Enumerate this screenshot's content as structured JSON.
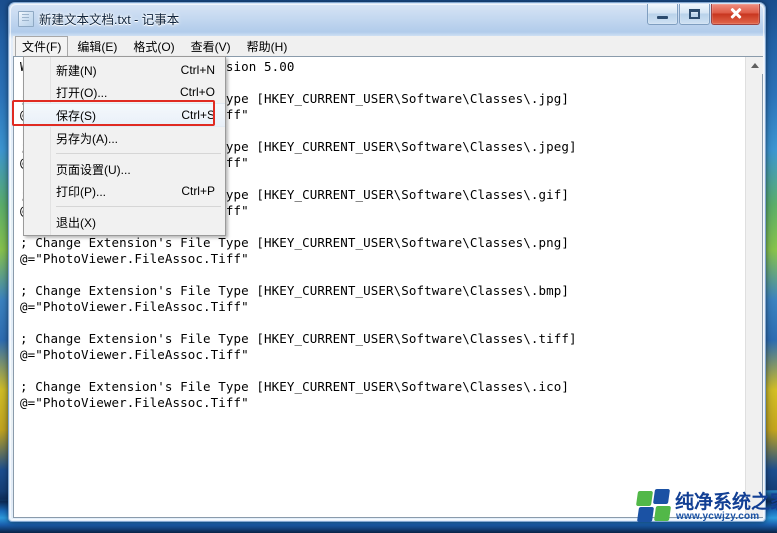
{
  "window": {
    "title": "新建文本文档.txt - 记事本",
    "icon": "notepad-document-icon",
    "controls": {
      "minimize": "最小化",
      "maximize": "最大化",
      "close": "关闭"
    }
  },
  "menubar": {
    "items": [
      {
        "label": "文件(F)",
        "active": true
      },
      {
        "label": "编辑(E)",
        "active": false
      },
      {
        "label": "格式(O)",
        "active": false
      },
      {
        "label": "查看(V)",
        "active": false
      },
      {
        "label": "帮助(H)",
        "active": false
      }
    ]
  },
  "file_menu": {
    "items": [
      {
        "label": "新建(N)",
        "accel": "Ctrl+N",
        "highlight": false,
        "separator_after": false
      },
      {
        "label": "打开(O)...",
        "accel": "Ctrl+O",
        "highlight": false,
        "separator_after": false
      },
      {
        "label": "保存(S)",
        "accel": "Ctrl+S",
        "highlight": true,
        "separator_after": false
      },
      {
        "label": "另存为(A)...",
        "accel": "",
        "highlight": false,
        "separator_after": true
      },
      {
        "label": "页面设置(U)...",
        "accel": "",
        "highlight": false,
        "separator_after": false
      },
      {
        "label": "打印(P)...",
        "accel": "Ctrl+P",
        "highlight": false,
        "separator_after": true
      },
      {
        "label": "退出(X)",
        "accel": "",
        "highlight": false,
        "separator_after": false
      }
    ]
  },
  "annotation": {
    "target": "保存(S)",
    "color": "#e02b22"
  },
  "editor": {
    "lines": [
      "Windows Registry Editor Version 5.00",
      "",
      "; Change Extension's File Type [HKEY_CURRENT_USER\\Software\\Classes\\.jpg]",
      "@=\"PhotoViewer.FileAssoc.Tiff\"",
      "",
      "; Change Extension's File Type [HKEY_CURRENT_USER\\Software\\Classes\\.jpeg]",
      "@=\"PhotoViewer.FileAssoc.Tiff\"",
      "",
      "; Change Extension's File Type [HKEY_CURRENT_USER\\Software\\Classes\\.gif]",
      "@=\"PhotoViewer.FileAssoc.Tiff\"",
      "",
      "; Change Extension's File Type [HKEY_CURRENT_USER\\Software\\Classes\\.png]",
      "@=\"PhotoViewer.FileAssoc.Tiff\"",
      "",
      "; Change Extension's File Type [HKEY_CURRENT_USER\\Software\\Classes\\.bmp]",
      "@=\"PhotoViewer.FileAssoc.Tiff\"",
      "",
      "; Change Extension's File Type [HKEY_CURRENT_USER\\Software\\Classes\\.tiff]",
      "@=\"PhotoViewer.FileAssoc.Tiff\"",
      "",
      "; Change Extension's File Type [HKEY_CURRENT_USER\\Software\\Classes\\.ico]",
      "@=\"PhotoViewer.FileAssoc.Tiff\""
    ]
  },
  "scrollbar": {
    "up_arrow": "scroll-up-arrow-icon",
    "down_arrow": "scroll-down-arrow-icon"
  },
  "watermark": {
    "name": "纯净系统之家",
    "url": "www.ycwjzy.com",
    "colors": {
      "blue": "#1b52a4",
      "green": "#52b848",
      "text": "#123f94"
    }
  }
}
